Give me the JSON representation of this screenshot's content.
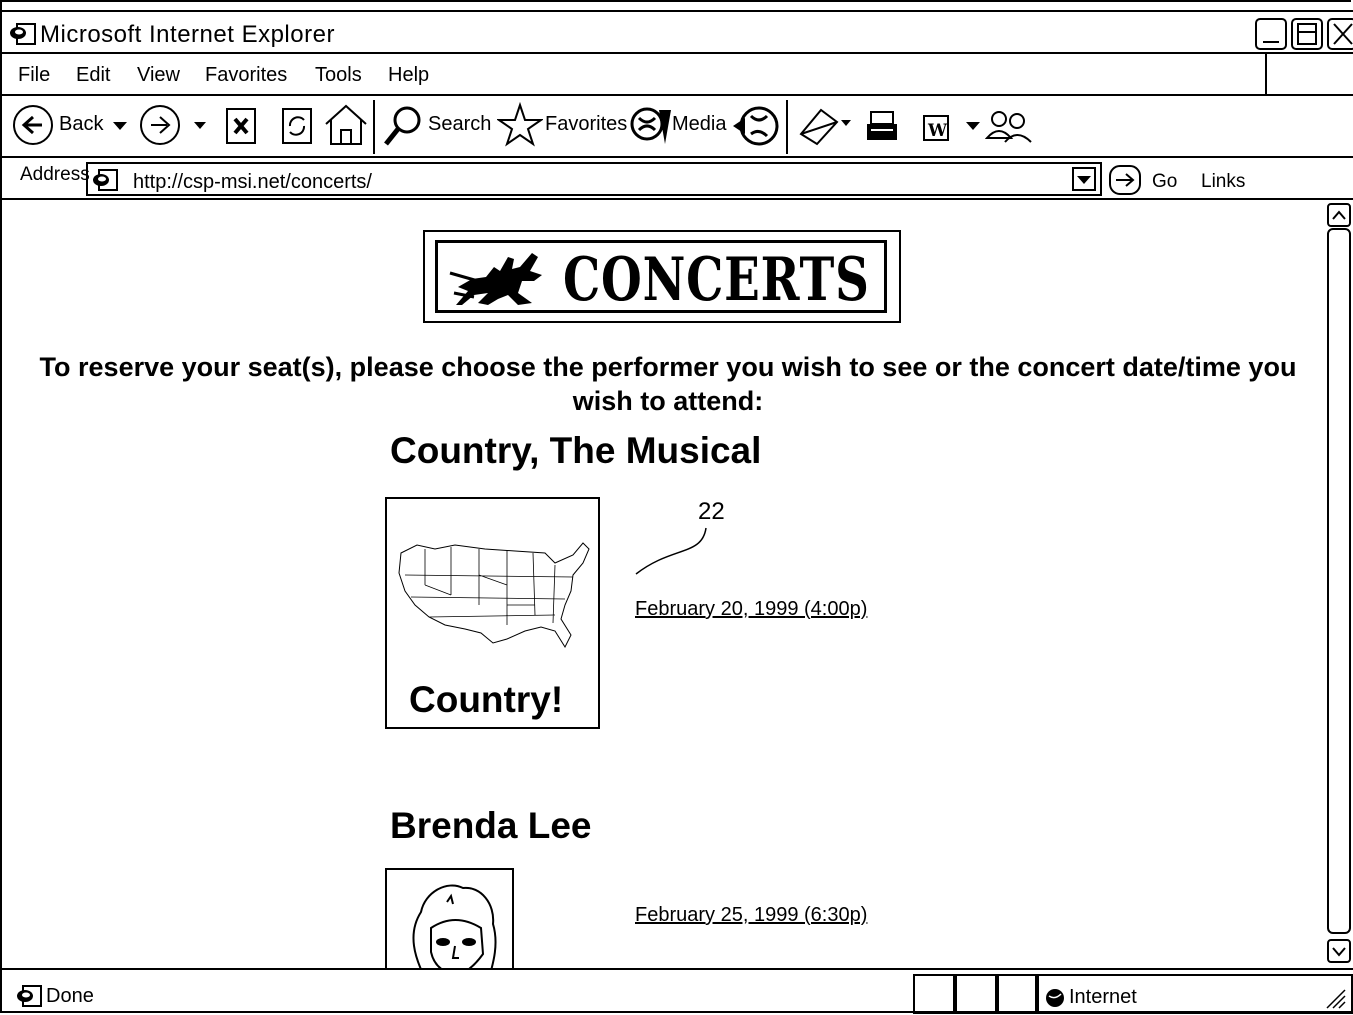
{
  "window": {
    "title": "Microsoft Internet Explorer"
  },
  "menu": {
    "items": [
      "File",
      "Edit",
      "View",
      "Favorites",
      "Tools",
      "Help"
    ]
  },
  "toolbar": {
    "back_label": "Back",
    "search_label": "Search",
    "favorites_label": "Favorites",
    "media_label": "Media"
  },
  "address": {
    "label": "Address",
    "url": "http://csp-msi.net/concerts/",
    "go_label": "Go",
    "links_label": "Links"
  },
  "page": {
    "banner_title": "CONCERTS",
    "instructions": "To reserve your seat(s), please choose the performer you wish to see or the concert date/time you wish to attend:",
    "performers": [
      {
        "name": "Country, The Musical",
        "image_caption": "Country!",
        "date": "February 20, 1999 (4:00p)"
      },
      {
        "name": "Brenda Lee",
        "date": "February 25, 1999 (6:30p)"
      }
    ],
    "reference_number": "22"
  },
  "status": {
    "text": "Done",
    "zone": "Internet"
  }
}
